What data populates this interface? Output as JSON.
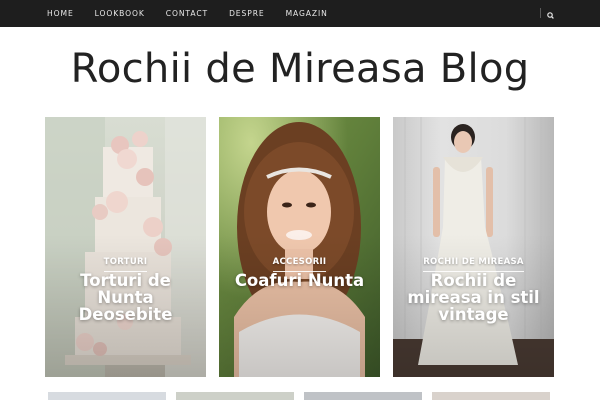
{
  "nav": {
    "items": [
      "HOME",
      "LOOKBOOK",
      "CONTACT",
      "DESPRE",
      "MAGAZIN"
    ],
    "search_icon": "search-icon"
  },
  "site": {
    "title": "Rochii de Mireasa Blog"
  },
  "cards": [
    {
      "category": "TORTURI",
      "title": "Torturi de Nunta Deosebite",
      "image": "wedding-cake-photo"
    },
    {
      "category": "ACCESORII",
      "title": "Coafuri Nunta",
      "image": "bride-hairstyle-photo"
    },
    {
      "category": "ROCHII DE MIREASA",
      "title": "Rochii de mireasa in stil vintage",
      "image": "vintage-dress-photo"
    }
  ],
  "thumbnails": [
    "thumb-photo-1",
    "thumb-photo-2",
    "thumb-photo-3",
    "thumb-photo-4"
  ]
}
